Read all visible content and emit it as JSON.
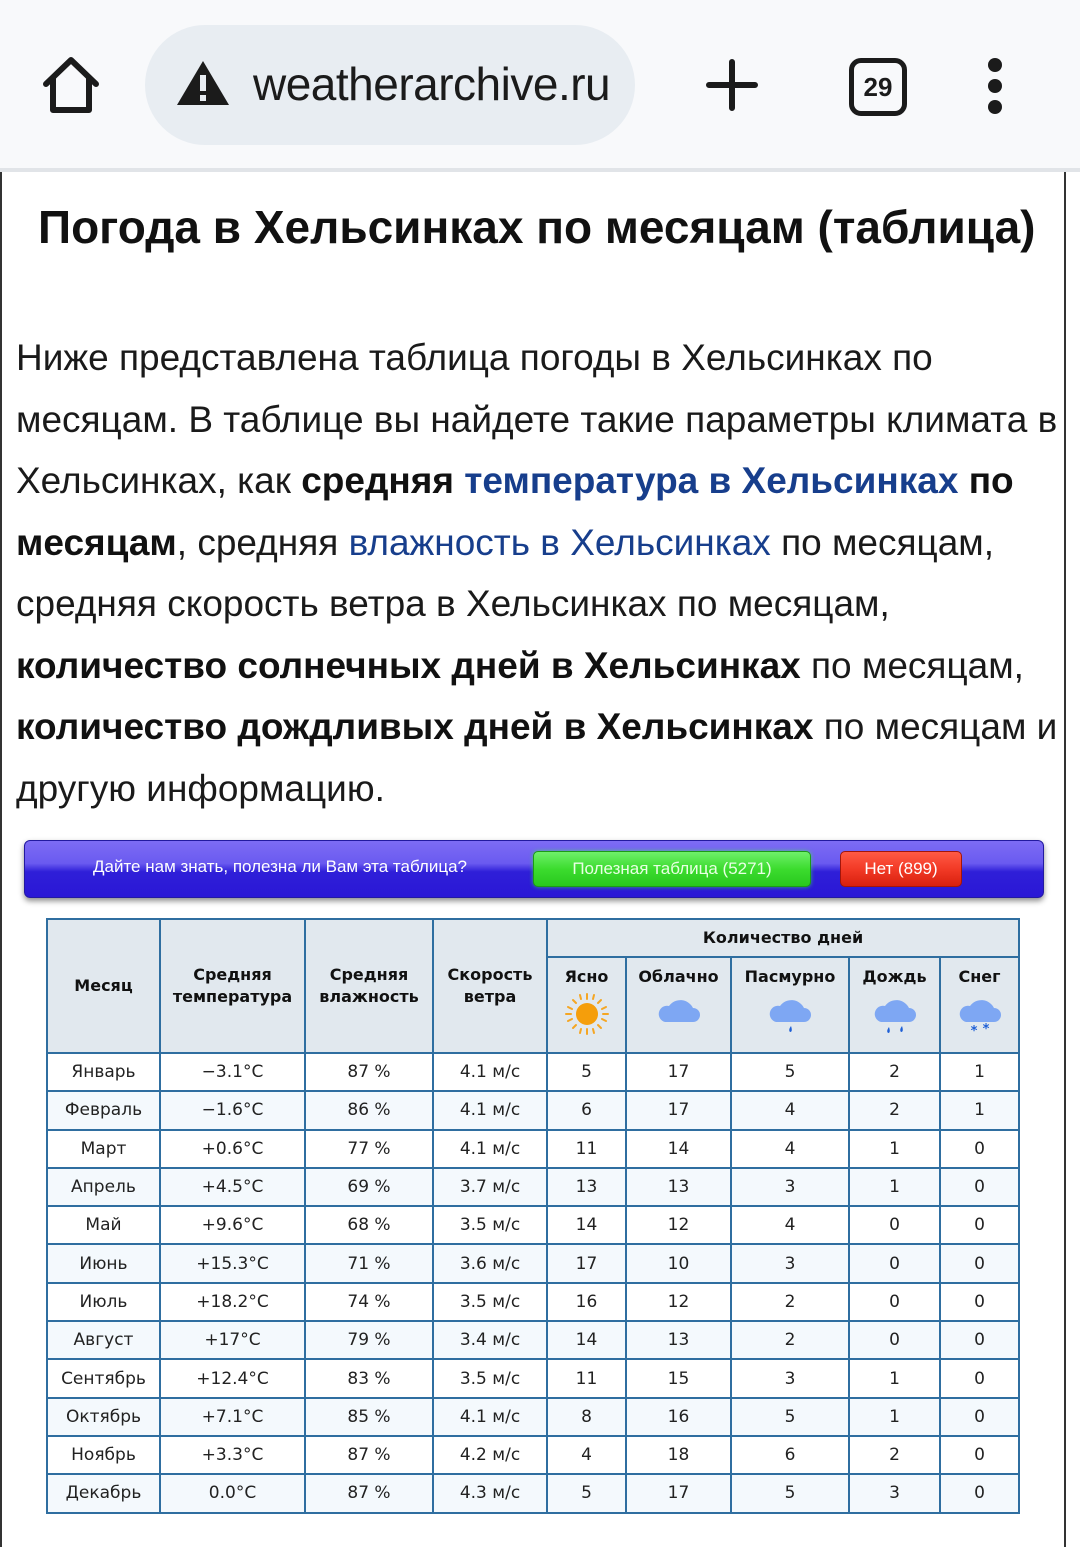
{
  "browser": {
    "url": "weatherarchive.ru",
    "tab_count": "29",
    "icons": {
      "home": "home-icon",
      "security": "warning-triangle-icon",
      "new_tab": "plus-icon",
      "tabs": "tab-switcher-icon",
      "menu": "more-vertical-icon"
    }
  },
  "page": {
    "title": "Погода в Хельсинках по месяцам (таблица)",
    "intro": {
      "t1": "Ниже представлена таблица погоды в Хельсинках по месяцам. В таблице вы найдете такие параметры климата в Хельсинках, как ",
      "b1": "средняя",
      "t2": " ",
      "link1": "температура в Хельсинках",
      "t3": " ",
      "b2": "по месяцам",
      "t4": ", средняя ",
      "link2": "влажность в Хельсинках",
      "t5": " по месяцам, средняя скорость ветра в Хельсинках по месяцам, ",
      "b3": "количество солнечных дней в Хельсинках",
      "t6": " по месяцам, ",
      "b4": "количество дождливых дней в Хельсинках",
      "t7": " по месяцам и другую информацию."
    },
    "link_color": "#173e8c"
  },
  "feedback": {
    "question": "Дайте нам знать, полезна ли Вам эта таблица?",
    "yes_label": "Полезная таблица (5271)",
    "no_label": "Нет (899)"
  },
  "table": {
    "headers": {
      "month": "Месяц",
      "temp": "Средняя температура",
      "humidity": "Средняя влажность",
      "wind": "Скорость ветра",
      "days_group": "Количество дней",
      "clear": "Ясно",
      "cloudy": "Облачно",
      "overcast": "Пасмурно",
      "rain": "Дождь",
      "snow": "Снег"
    },
    "header_icons": {
      "clear": "sun-icon",
      "cloudy": "cloud-icon",
      "overcast": "cloud-drizzle-icon",
      "rain": "cloud-rain-icon",
      "snow": "cloud-snow-icon"
    },
    "rows": [
      {
        "month": "Январь",
        "temp": "−3.1°C",
        "humidity": "87 %",
        "wind": "4.1 м/с",
        "clear": "5",
        "cloudy": "17",
        "overcast": "5",
        "rain": "2",
        "snow": "1"
      },
      {
        "month": "Февраль",
        "temp": "−1.6°C",
        "humidity": "86 %",
        "wind": "4.1 м/с",
        "clear": "6",
        "cloudy": "17",
        "overcast": "4",
        "rain": "2",
        "snow": "1"
      },
      {
        "month": "Март",
        "temp": "+0.6°C",
        "humidity": "77 %",
        "wind": "4.1 м/с",
        "clear": "11",
        "cloudy": "14",
        "overcast": "4",
        "rain": "1",
        "snow": "0"
      },
      {
        "month": "Апрель",
        "temp": "+4.5°C",
        "humidity": "69 %",
        "wind": "3.7 м/с",
        "clear": "13",
        "cloudy": "13",
        "overcast": "3",
        "rain": "1",
        "snow": "0"
      },
      {
        "month": "Май",
        "temp": "+9.6°C",
        "humidity": "68 %",
        "wind": "3.5 м/с",
        "clear": "14",
        "cloudy": "12",
        "overcast": "4",
        "rain": "0",
        "snow": "0"
      },
      {
        "month": "Июнь",
        "temp": "+15.3°C",
        "humidity": "71 %",
        "wind": "3.6 м/с",
        "clear": "17",
        "cloudy": "10",
        "overcast": "3",
        "rain": "0",
        "snow": "0"
      },
      {
        "month": "Июль",
        "temp": "+18.2°C",
        "humidity": "74 %",
        "wind": "3.5 м/с",
        "clear": "16",
        "cloudy": "12",
        "overcast": "2",
        "rain": "0",
        "snow": "0"
      },
      {
        "month": "Август",
        "temp": "+17°C",
        "humidity": "79 %",
        "wind": "3.4 м/с",
        "clear": "14",
        "cloudy": "13",
        "overcast": "2",
        "rain": "0",
        "snow": "0"
      },
      {
        "month": "Сентябрь",
        "temp": "+12.4°C",
        "humidity": "83 %",
        "wind": "3.5 м/с",
        "clear": "11",
        "cloudy": "15",
        "overcast": "3",
        "rain": "1",
        "snow": "0"
      },
      {
        "month": "Октябрь",
        "temp": "+7.1°C",
        "humidity": "85 %",
        "wind": "4.1 м/с",
        "clear": "8",
        "cloudy": "16",
        "overcast": "5",
        "rain": "1",
        "snow": "0"
      },
      {
        "month": "Ноябрь",
        "temp": "+3.3°C",
        "humidity": "87 %",
        "wind": "4.2 м/с",
        "clear": "4",
        "cloudy": "18",
        "overcast": "6",
        "rain": "2",
        "snow": "0"
      },
      {
        "month": "Декабрь",
        "temp": "0.0°C",
        "humidity": "87 %",
        "wind": "4.3 м/с",
        "clear": "5",
        "cloudy": "17",
        "overcast": "5",
        "rain": "3",
        "snow": "0"
      }
    ]
  }
}
